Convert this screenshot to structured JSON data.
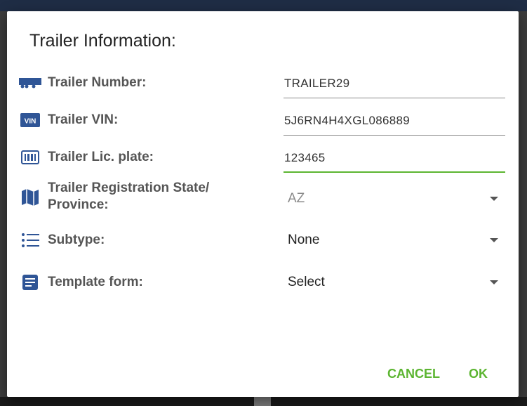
{
  "dialog": {
    "title": "Trailer Information:"
  },
  "fields": {
    "trailer_number": {
      "label": "Trailer Number:",
      "value": "TRAILER29",
      "icon": "trailer-icon"
    },
    "trailer_vin": {
      "label": "Trailer VIN:",
      "value": "5J6RN4H4XGL086889",
      "icon": "vin-icon"
    },
    "trailer_plate": {
      "label": "Trailer Lic. plate:",
      "value": "123465",
      "icon": "license-plate-icon"
    },
    "registration_state": {
      "label_line1": "Trailer Registration State/",
      "label_line2": "Province:",
      "value": "AZ",
      "icon": "map-icon"
    },
    "subtype": {
      "label": "Subtype:",
      "value": "None",
      "icon": "list-icon"
    },
    "template_form": {
      "label": "Template form:",
      "value": "Select",
      "icon": "form-icon"
    }
  },
  "actions": {
    "cancel_label": "CANCEL",
    "ok_label": "OK"
  },
  "colors": {
    "accent": "#5cb531",
    "icon": "#2f5596"
  }
}
